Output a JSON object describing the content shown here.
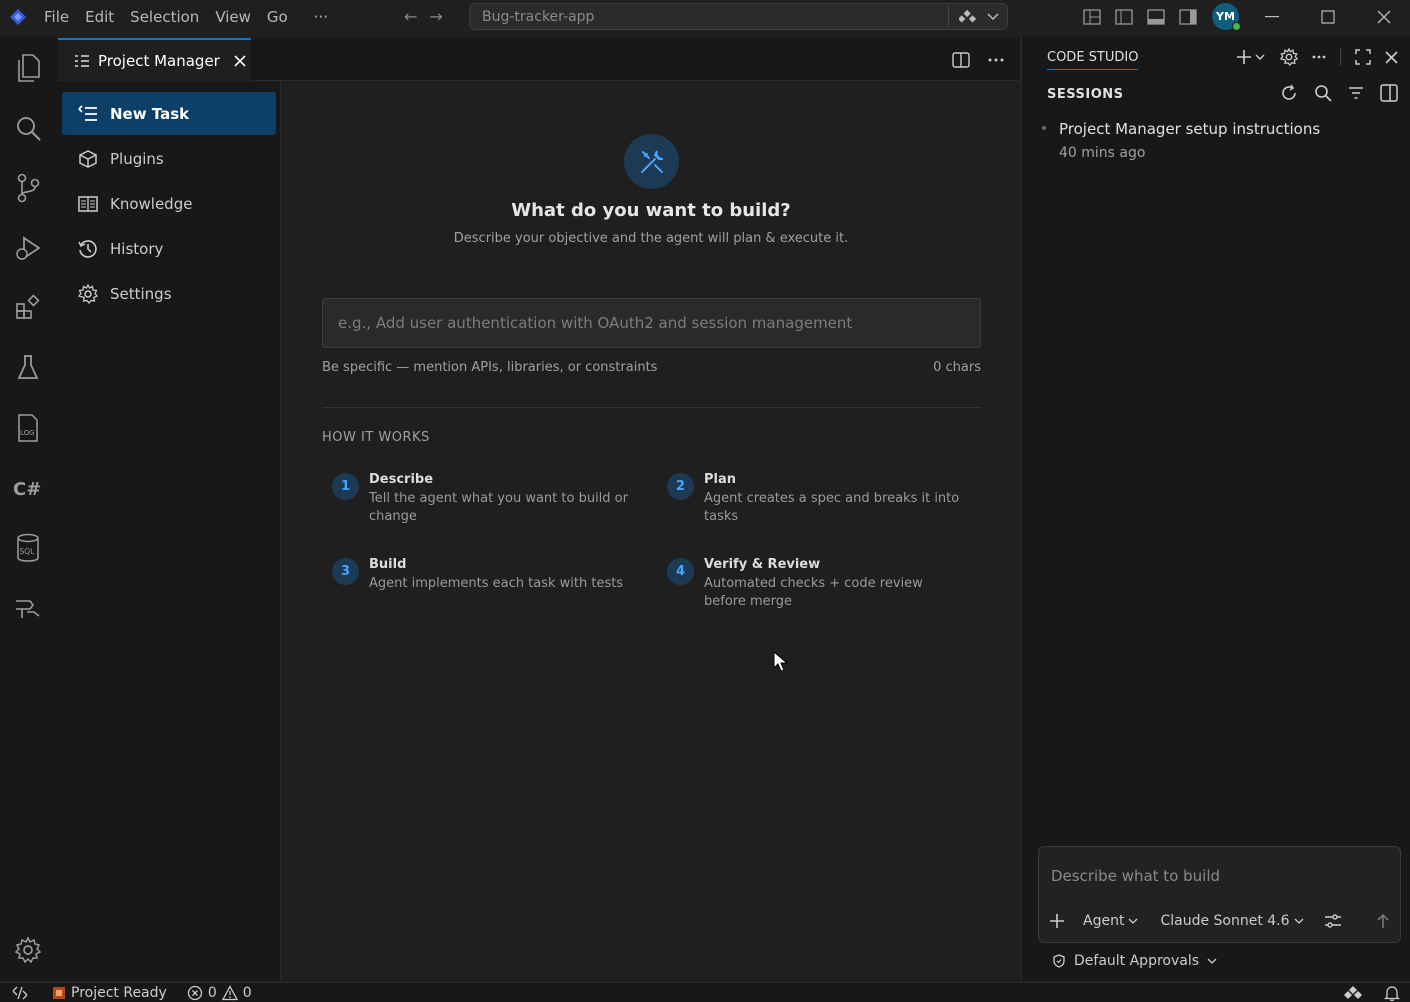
{
  "menu": [
    "File",
    "Edit",
    "Selection",
    "View",
    "Go",
    "···"
  ],
  "command_center": {
    "text": "Bug-tracker-app"
  },
  "avatar": {
    "initials": "YM"
  },
  "tab": {
    "label": "Project Manager"
  },
  "nav": {
    "items": [
      {
        "label": "New Task",
        "icon": "list-icon",
        "active": true
      },
      {
        "label": "Plugins",
        "icon": "package-icon"
      },
      {
        "label": "Knowledge",
        "icon": "book-icon"
      },
      {
        "label": "History",
        "icon": "history-icon"
      },
      {
        "label": "Settings",
        "icon": "gear-icon"
      }
    ]
  },
  "main": {
    "title": "What do you want to build?",
    "subtitle": "Describe your objective and the agent will plan & execute it.",
    "input_placeholder": "e.g., Add user authentication with OAuth2 and session management",
    "hint": "Be specific — mention APIs, libraries, or constraints",
    "chars": "0 chars",
    "how_title": "HOW IT WORKS",
    "steps": [
      {
        "num": "1",
        "title": "Describe",
        "desc": "Tell the agent what you want to build or change"
      },
      {
        "num": "2",
        "title": "Plan",
        "desc": "Agent creates a spec and breaks it into tasks"
      },
      {
        "num": "3",
        "title": "Build",
        "desc": "Agent implements each task with tests"
      },
      {
        "num": "4",
        "title": "Verify & Review",
        "desc": "Automated checks + code review before merge"
      }
    ]
  },
  "right_panel": {
    "header": "CODE STUDIO",
    "sessions_title": "SESSIONS",
    "sessions": [
      {
        "name": "Project Manager setup instructions",
        "time": "40 mins ago"
      }
    ],
    "chat_placeholder": "Describe what to build",
    "mode": "Agent",
    "model": "Claude Sonnet 4.6",
    "approvals": "Default Approvals"
  },
  "status": {
    "project": "Project Ready",
    "errors": "0",
    "warnings": "0"
  },
  "colors": {
    "accent": "#0078d4",
    "active_nav": "#0e3f66",
    "step_num": "#4aa3ff",
    "online": "#3fb950"
  }
}
